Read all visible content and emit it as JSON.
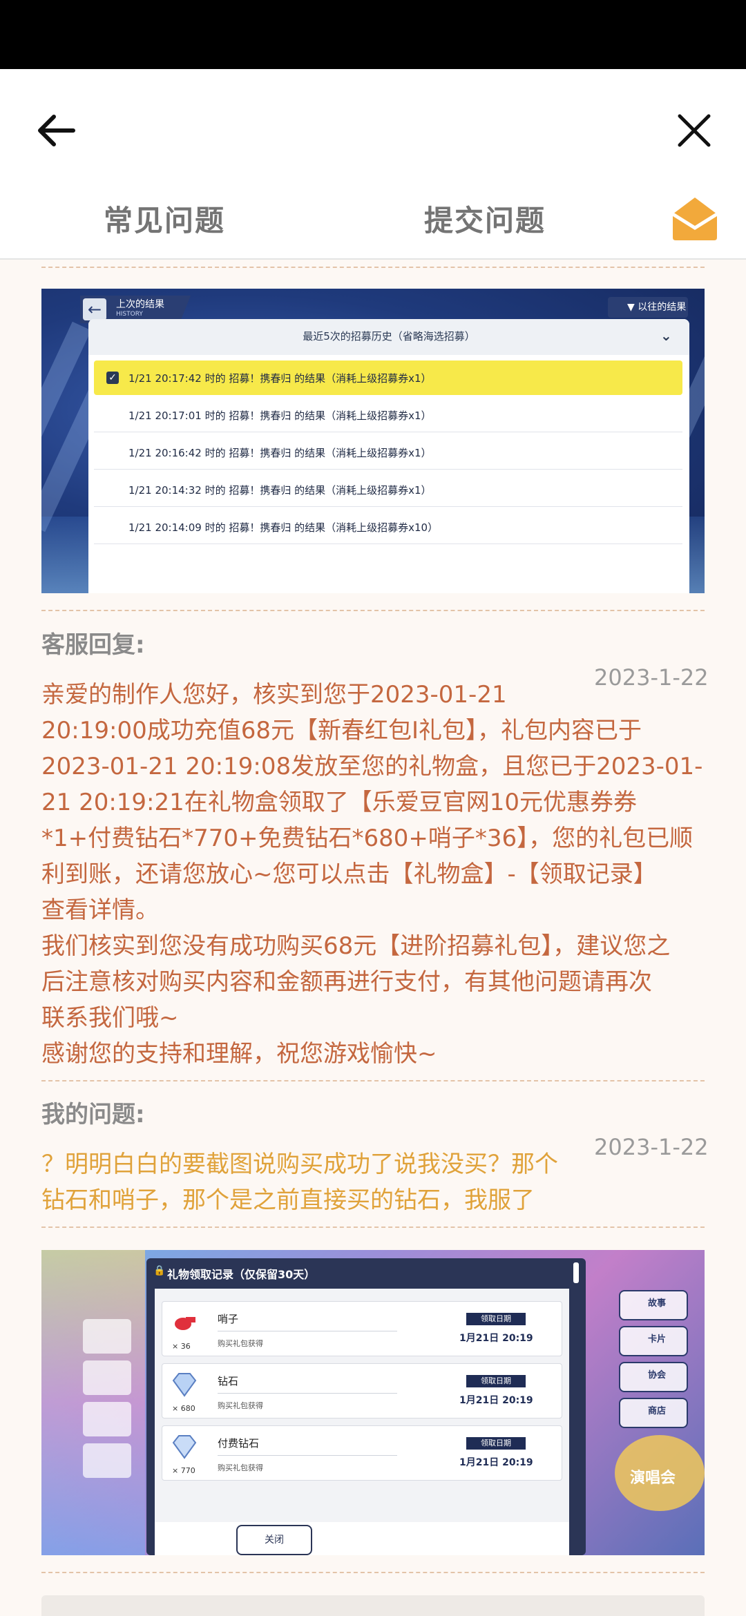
{
  "header": {
    "tab_faq": "常见问题",
    "tab_submit": "提交问题"
  },
  "screenshot1": {
    "header_left_title": "上次的结果",
    "header_left_sub": "HISTORY",
    "header_right": "以往的结果",
    "panel_title": "最近5次的招募历史（省略海选招募）",
    "rows": [
      {
        "text": "1/21 20:17:42 时的 招募！携春归 的结果（消耗上级招募券x1）",
        "selected": true
      },
      {
        "text": "1/21 20:17:01 时的 招募！携春归 的结果（消耗上级招募券x1）",
        "selected": false
      },
      {
        "text": "1/21 20:16:42 时的 招募！携春归 的结果（消耗上级招募券x1）",
        "selected": false
      },
      {
        "text": "1/21 20:14:32 时的 招募！携春归 的结果（消耗上级招募券x1）",
        "selected": false
      },
      {
        "text": "1/21 20:14:09 时的 招募！携春归 的结果（消耗上级招募券x10）",
        "selected": false
      }
    ]
  },
  "reply": {
    "label": "客服回复:",
    "date": "2023-1-22",
    "lines": [
      "亲爱的制作人您好，核实到您于2023-01-21",
      "20:19:00成功充值68元【新春红包I礼包】，礼包内容已于",
      "2023-01-21 20:19:08发放至您的礼物盒，且您已于2023-01-",
      "21 20:19:21在礼物盒领取了【乐爱豆官网10元优惠券券",
      "*1+付费钻石*770+免费钻石*680+哨子*36】，您的礼包已顺",
      "利到账，还请您放心~您可以点击【礼物盒】-【领取记录】",
      "查看详情。",
      "我们核实到您没有成功购买68元【进阶招募礼包】，建议您之",
      "后注意核对购买内容和金额再进行支付，有其他问题请再次",
      "联系我们哦~",
      "感谢您的支持和理解，祝您游戏愉快~"
    ]
  },
  "question": {
    "label": "我的问题:",
    "date": "2023-1-22",
    "lines": [
      "？明明白白的要截图说购买成功了说我没买？那个",
      "钻石和哨子，那个是之前直接买的钻石，我服了"
    ]
  },
  "screenshot2": {
    "dialog_title": "礼物领取记录（仅保留30天）",
    "date_tag": "领取日期",
    "close_label": "关闭",
    "side_menu": [
      "故事",
      "卡片",
      "协会",
      "商店"
    ],
    "concert_label": "演唱会",
    "items": [
      {
        "name": "哨子",
        "qty": "× 36",
        "source": "购买礼包获得",
        "date": "1月21日 20:19",
        "icon": "whistle-icon"
      },
      {
        "name": "钻石",
        "qty": "× 680",
        "source": "购买礼包获得",
        "date": "1月21日 20:19",
        "icon": "diamond-icon"
      },
      {
        "name": "付费钻石",
        "qty": "× 770",
        "source": "购买礼包获得",
        "date": "1月21日 20:19",
        "icon": "paid-diamond-icon"
      }
    ]
  },
  "colors": {
    "reply_text": "#c4673f",
    "question_text": "#e0a23a",
    "mail_icon": "#f2a93b",
    "background": "#fdf8f4"
  }
}
